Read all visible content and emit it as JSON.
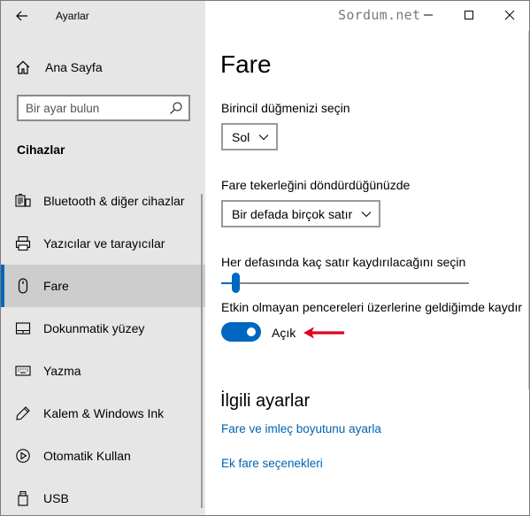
{
  "window": {
    "app_title": "Ayarlar",
    "watermark": "Sordum.net"
  },
  "sidebar": {
    "home_label": "Ana Sayfa",
    "search_placeholder": "Bir ayar bulun",
    "section_title": "Cihazlar",
    "items": [
      {
        "label": "Bluetooth & diğer cihazlar",
        "icon": "bluetooth-devices-icon"
      },
      {
        "label": "Yazıcılar ve tarayıcılar",
        "icon": "printer-icon"
      },
      {
        "label": "Fare",
        "icon": "mouse-icon",
        "selected": true
      },
      {
        "label": "Dokunmatik yüzey",
        "icon": "touchpad-icon"
      },
      {
        "label": "Yazma",
        "icon": "keyboard-icon"
      },
      {
        "label": "Kalem & Windows Ink",
        "icon": "pen-icon"
      },
      {
        "label": "Otomatik Kullan",
        "icon": "autoplay-icon"
      },
      {
        "label": "USB",
        "icon": "usb-icon"
      }
    ]
  },
  "main": {
    "title": "Fare",
    "primary_button_label": "Birincil düğmenizi seçin",
    "primary_button_value": "Sol",
    "wheel_label": "Fare tekerleğini döndürdüğünüzde",
    "wheel_value": "Bir defada birçok satır",
    "lines_label": "Her defasında kaç satır kaydırılacağını seçin",
    "lines_slider_fraction": 0.03,
    "inactive_scroll_label": "Etkin olmayan pencereleri üzerlerine geldiğimde kaydır",
    "inactive_scroll_state": "Açık",
    "related_title": "İlgili ayarlar",
    "links": [
      "Fare ve imleç boyutunu ayarla",
      "Ek fare seçenekleri"
    ]
  },
  "colors": {
    "accent": "#0067c0",
    "link": "#0063b1",
    "sidebar_bg": "#e6e6e6",
    "arrow": "#e0001a"
  }
}
